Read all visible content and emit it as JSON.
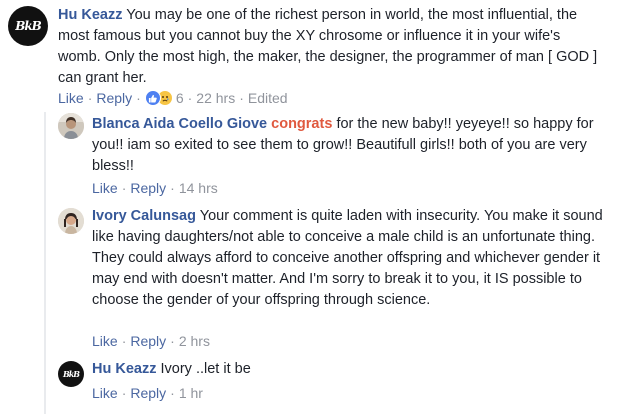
{
  "comments": [
    {
      "author": "Hu Keazz",
      "text": "You may be one of the richest person in world, the most influential, the most famous but you cannot buy the XY chrosome or influence it in your wife's womb. Only the most high, the maker, the designer, the programmer of man [ GOD ] can grant her.",
      "like_label": "Like",
      "reply_label": "Reply",
      "reaction_count": "6",
      "time": "22 hrs",
      "edited": "Edited",
      "avatar_text": "BkB"
    },
    {
      "author": "Blanca Aida Coello Giove",
      "mention": "congrats",
      "text": "for the new baby!! yeyeye!! so happy for you!! iam so exited to see them to grow!! Beautifull girls!! both of you are very bless!!",
      "like_label": "Like",
      "reply_label": "Reply",
      "time": "14 hrs"
    },
    {
      "author": "Ivory Calunsag",
      "text": "Your comment is quite laden with insecurity. You make it sound like having daughters/not able to conceive a male child is an unfortunate thing. They could always afford to conceive another offspring and whichever gender it may end with doesn't matter. And I'm sorry to break it to you, it IS possible to choose the gender of your offspring through science.",
      "like_label": "Like",
      "reply_label": "Reply",
      "time": "2 hrs"
    },
    {
      "author": "Hu Keazz",
      "text": "Ivory ..let it be",
      "like_label": "Like",
      "reply_label": "Reply",
      "time": "1 hr",
      "avatar_text": "BkB"
    }
  ],
  "separator": "·",
  "colors": {
    "author": "#365899",
    "mention": "#e0593f",
    "link": "#4b67a1",
    "meta": "#90949c"
  }
}
